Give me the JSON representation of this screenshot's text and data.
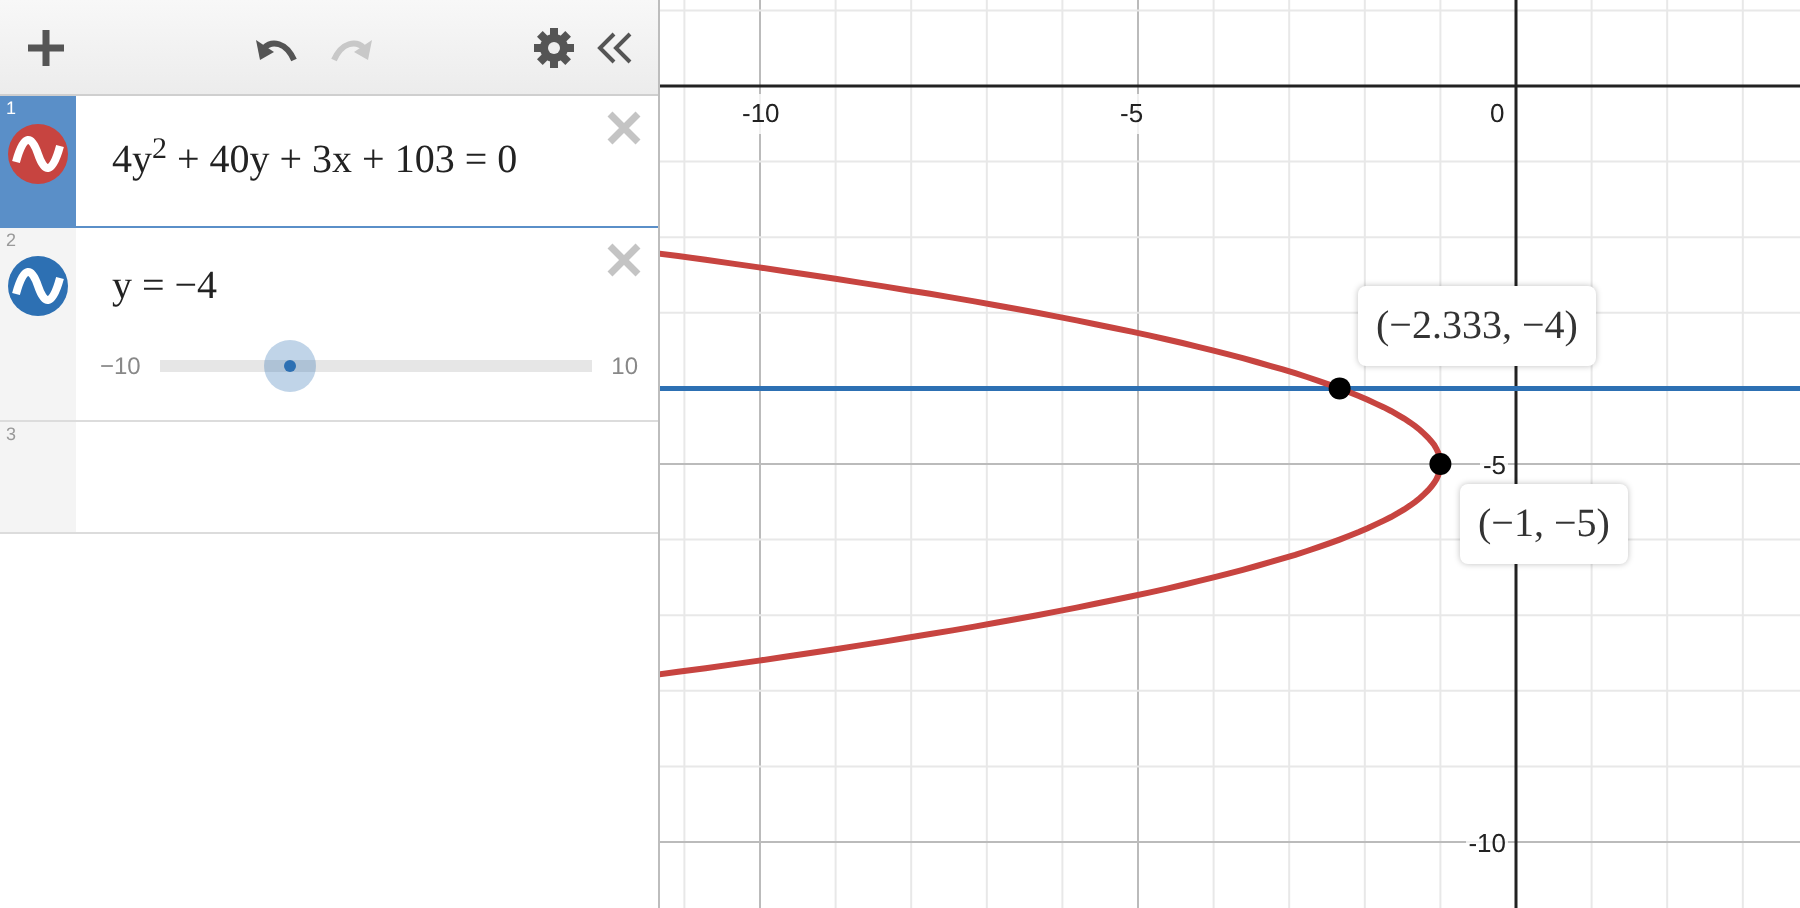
{
  "toolbar": {
    "redo_disabled": true
  },
  "expressions": [
    {
      "number": "1",
      "color": "#c74440",
      "latex": "4y$^{2}$ + 40y + 3x + 103 = 0",
      "selected": true
    },
    {
      "number": "2",
      "color": "#2d70b3",
      "latex": "y = −4",
      "selected": false,
      "slider": {
        "min": "−10",
        "max": "10"
      }
    },
    {
      "number": "3",
      "selected": false
    }
  ],
  "graph": {
    "x_tick_labels": [
      "-10",
      "-5",
      "0"
    ],
    "y_tick_labels": [
      "-5",
      "-10"
    ],
    "point_labels": [
      "(−2.333, −4)",
      "(−1, −5)"
    ]
  }
}
